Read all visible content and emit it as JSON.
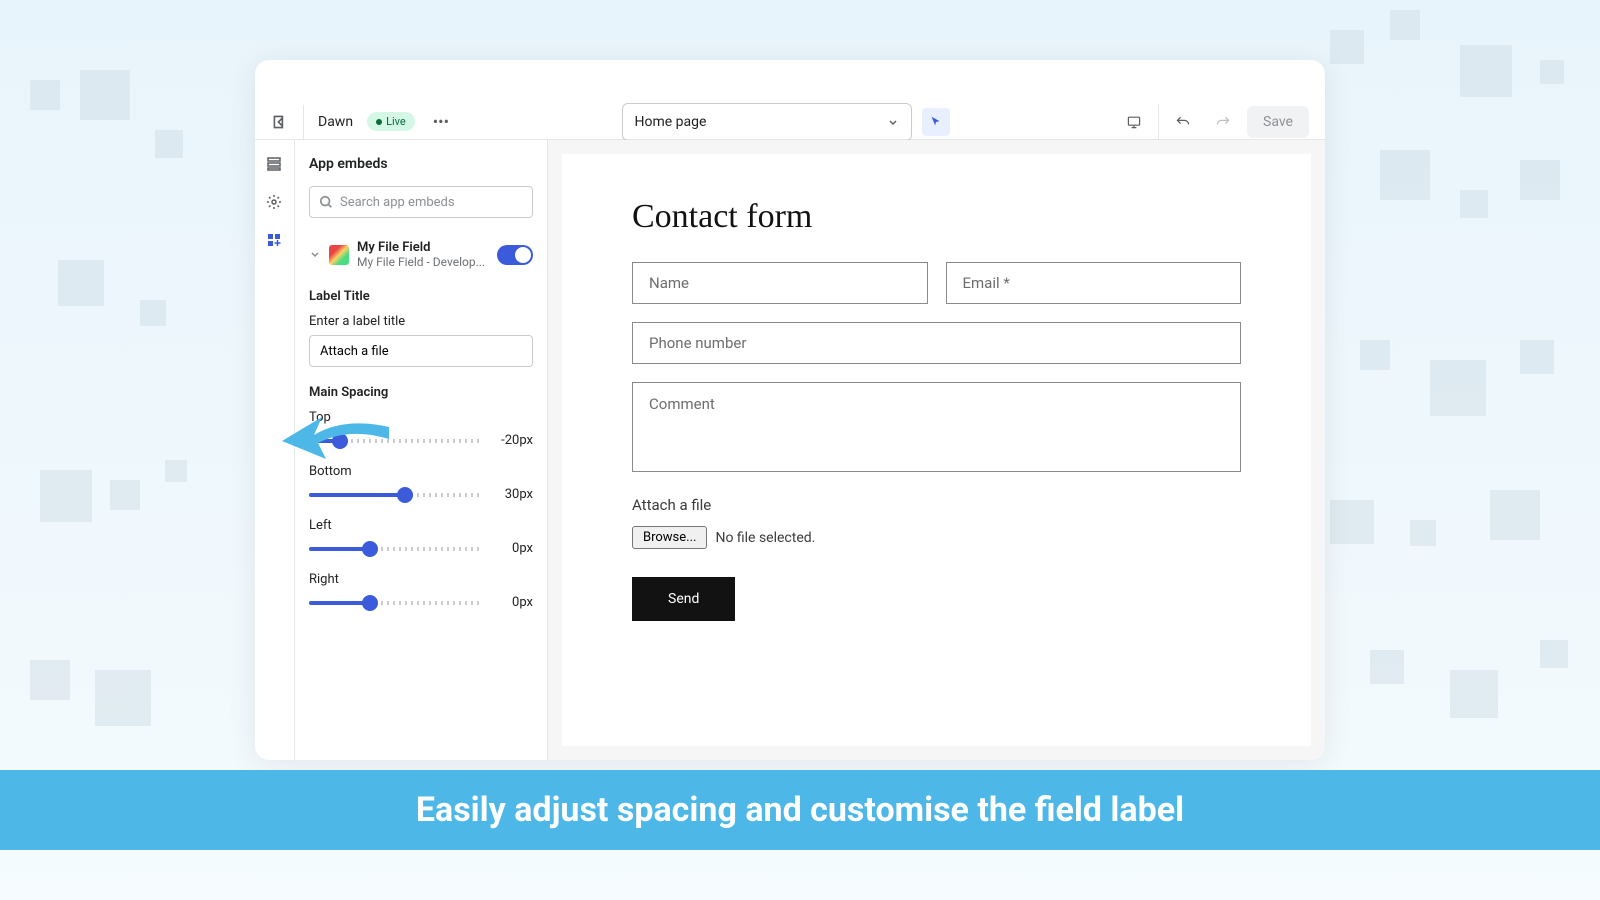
{
  "topbar": {
    "theme": "Dawn",
    "badge": "Live",
    "pageSelect": "Home page",
    "save": "Save"
  },
  "sidebar": {
    "title": "App embeds",
    "searchPlaceholder": "Search app embeds",
    "app": {
      "name": "My File Field",
      "sub": "My File Field - Develop..."
    },
    "labelTitleHeading": "Label Title",
    "labelTitleFieldLabel": "Enter a label title",
    "labelTitleValue": "Attach a file",
    "mainSpacingHeading": "Main Spacing",
    "sliders": {
      "top": {
        "label": "Top",
        "value": "-20px",
        "percent": 18
      },
      "bottom": {
        "label": "Bottom",
        "value": "30px",
        "percent": 55
      },
      "left": {
        "label": "Left",
        "value": "0px",
        "percent": 35
      },
      "right": {
        "label": "Right",
        "value": "0px",
        "percent": 35
      }
    }
  },
  "form": {
    "title": "Contact form",
    "name": "Name",
    "email": "Email *",
    "phone": "Phone number",
    "comment": "Comment",
    "attach": "Attach a file",
    "browse": "Browse...",
    "nofile": "No file selected.",
    "send": "Send"
  },
  "caption": "Easily adjust spacing and customise the field label"
}
